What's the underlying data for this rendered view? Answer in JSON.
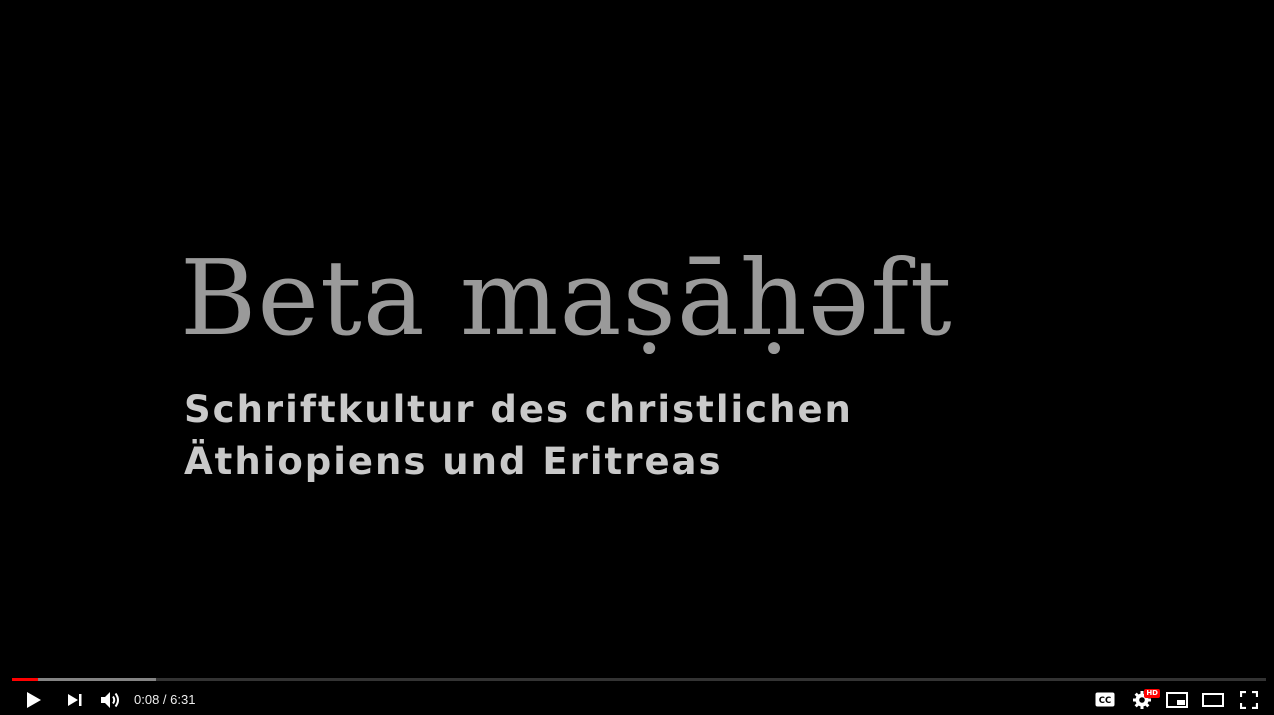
{
  "video": {
    "title_line": "Beta maṣāḥəft",
    "subtitle_line1": "Schriftkultur des christlichen",
    "subtitle_line2": "Äthiopiens und Eritreas"
  },
  "player": {
    "time_current": "0:08",
    "time_separator": " / ",
    "time_total": "6:31",
    "played_fraction": 0.0205,
    "buffered_fraction": 0.115,
    "quality_badge": "HD",
    "accent_color": "#ff0000"
  },
  "icons": {
    "play": "play-icon",
    "next": "next-icon",
    "volume": "volume-icon",
    "captions": "captions-icon",
    "settings": "settings-icon",
    "miniplayer": "miniplayer-icon",
    "theater": "theater-icon",
    "fullscreen": "fullscreen-icon"
  }
}
